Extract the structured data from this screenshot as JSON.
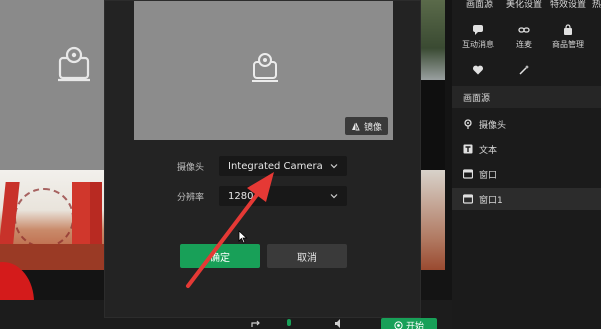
{
  "camera_dialog": {
    "mirror_label": "镜像",
    "camera_label": "摄像头",
    "camera_value": "Integrated Camera",
    "resolution_label": "分辨率",
    "resolution_value": "1280",
    "ok_label": "确定",
    "cancel_label": "取消"
  },
  "right_panel": {
    "tabs": [
      "画面源",
      "美化设置",
      "特效设置",
      "热"
    ],
    "tools": [
      "互动消息",
      "连麦",
      "商品管理"
    ],
    "sources_title": "画面源",
    "sources": [
      "摄像头",
      "文本",
      "窗口",
      "窗口1"
    ]
  },
  "bottom_bar": {
    "start_label": "开始"
  },
  "colors": {
    "accent_green": "#18a058",
    "annotation_red": "#e53935",
    "dialog_bg": "#232323",
    "panel_bg": "#1b1b1b"
  },
  "icons": [
    "camera-icon",
    "mirror-icon",
    "chevron-down-icon",
    "chat-icon",
    "link-icon",
    "bag-icon",
    "heart-icon",
    "magic-icon",
    "location-pin-icon",
    "text-t-icon",
    "window-icon",
    "microphone-icon",
    "speaker-icon",
    "play-circle-icon"
  ]
}
